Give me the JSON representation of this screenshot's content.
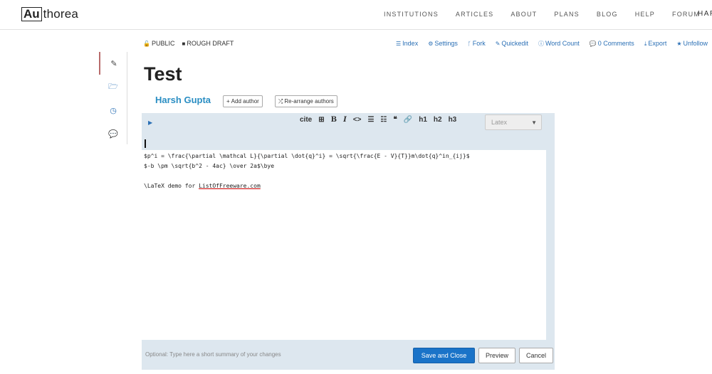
{
  "header": {
    "logo_box": "Au",
    "logo_rest": "thorea",
    "nav": [
      "INSTITUTIONS",
      "ARTICLES",
      "ABOUT",
      "PLANS",
      "BLOG",
      "HELP",
      "FORUM"
    ],
    "user": "HAR"
  },
  "status": {
    "public": "PUBLIC",
    "draft": "ROUGH DRAFT"
  },
  "doctools": {
    "index": "Index",
    "settings": "Settings",
    "fork": "Fork",
    "quickedit": "Quickedit",
    "wordcount": "Word Count",
    "comments": "0 Comments",
    "export": "Export",
    "unfollow": "Unfollow"
  },
  "doc": {
    "title": "Test",
    "author": "Harsh Gupta",
    "add_author": "Add author",
    "rearrange": "Re-arrange authors"
  },
  "editor": {
    "toolbar": {
      "cite": "cite",
      "h1": "h1",
      "h2": "h2",
      "h3": "h3"
    },
    "language": "Latex",
    "lines": [
      "$p^i = \\frac{\\partial \\mathcal L}{\\partial \\dot{q}^i} = \\sqrt{\\frac{E - V}{T}}m\\dot{q}^in_{ij}$",
      "$-b \\pm \\sqrt{b^2 - 4ac} \\over 2a$\\bye",
      "",
      "\\LaTeX demo for "
    ],
    "link_word": "ListOfFreeware.com",
    "summary_placeholder": "Optional: Type here a short summary of your changes",
    "save_label": "Save and Close",
    "preview_label": "Preview",
    "cancel_label": "Cancel"
  }
}
